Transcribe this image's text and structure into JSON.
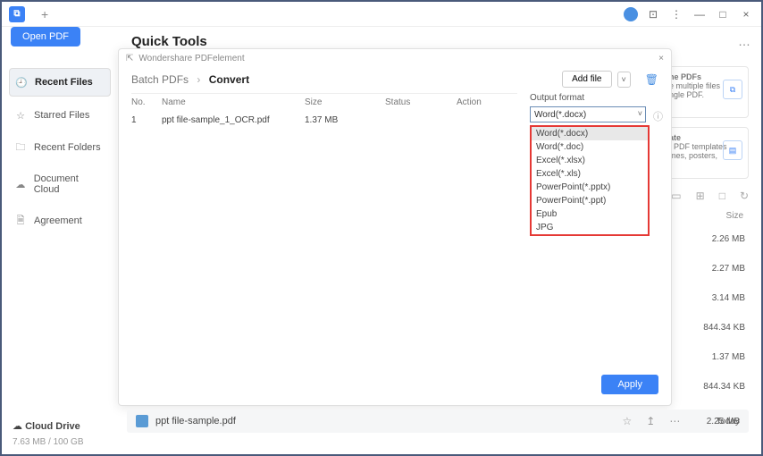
{
  "titlebar": {
    "plus": "+",
    "min": "—",
    "max": "□",
    "close": "×",
    "dots": "⋮"
  },
  "header": {
    "title": "Quick Tools",
    "more": "…"
  },
  "sidebar": {
    "open_pdf": "Open PDF",
    "items": [
      {
        "icon": "🕘",
        "label": "Recent Files"
      },
      {
        "icon": "☆",
        "label": "Starred Files"
      },
      {
        "icon": "🗀",
        "label": "Recent Folders"
      },
      {
        "icon": "☁",
        "label": "Document Cloud"
      },
      {
        "icon": "🗎",
        "label": "Agreement"
      }
    ],
    "cloud": {
      "title": "Cloud Drive",
      "usage": "7.63 MB / 100 GB"
    }
  },
  "cards": {
    "combine": {
      "title_tail": "ne PDFs",
      "l1": "e multiple files",
      "l2": "ngle PDF."
    },
    "template": {
      "title_tail": "ate",
      "l1": "t PDF templates",
      "l2": "mes, posters,"
    }
  },
  "toolbar": {
    "i1": "▭",
    "i2": "⊞",
    "i3": "□",
    "i4": "↻"
  },
  "sizes": {
    "header": "Size",
    "rows": [
      "2.26 MB",
      "2.27 MB",
      "3.14 MB",
      "844.34 KB",
      "1.37 MB",
      "844.34 KB",
      "2.25 MB"
    ]
  },
  "modal": {
    "app_hint": "Wondershare PDFelement",
    "close": "×",
    "breadcrumb": {
      "root": "Batch PDFs",
      "chev": "›",
      "leaf": "Convert"
    },
    "add_file": "Add file",
    "add_chev": "˅",
    "trash": "🗑",
    "columns": {
      "no": "No.",
      "name": "Name",
      "size": "Size",
      "status": "Status",
      "action": "Action"
    },
    "rows": [
      {
        "no": "1",
        "name": "ppt file-sample_1_OCR.pdf",
        "size": "1.37 MB",
        "status": "",
        "action": ""
      }
    ],
    "output": {
      "label": "Output format",
      "selected": "Word(*.docx)",
      "info": "ⓘ",
      "options": [
        "Word(*.docx)",
        "Word(*.doc)",
        "Excel(*.xlsx)",
        "Excel(*.xls)",
        "PowerPoint(*.pptx)",
        "PowerPoint(*.ppt)",
        "Epub",
        "JPG"
      ]
    },
    "apply": "Apply"
  },
  "recent_row": {
    "name": "ppt file-sample.pdf",
    "star": "☆",
    "up": "↥",
    "more": "⋯",
    "date": "Today",
    "size": "2.25 MB"
  }
}
